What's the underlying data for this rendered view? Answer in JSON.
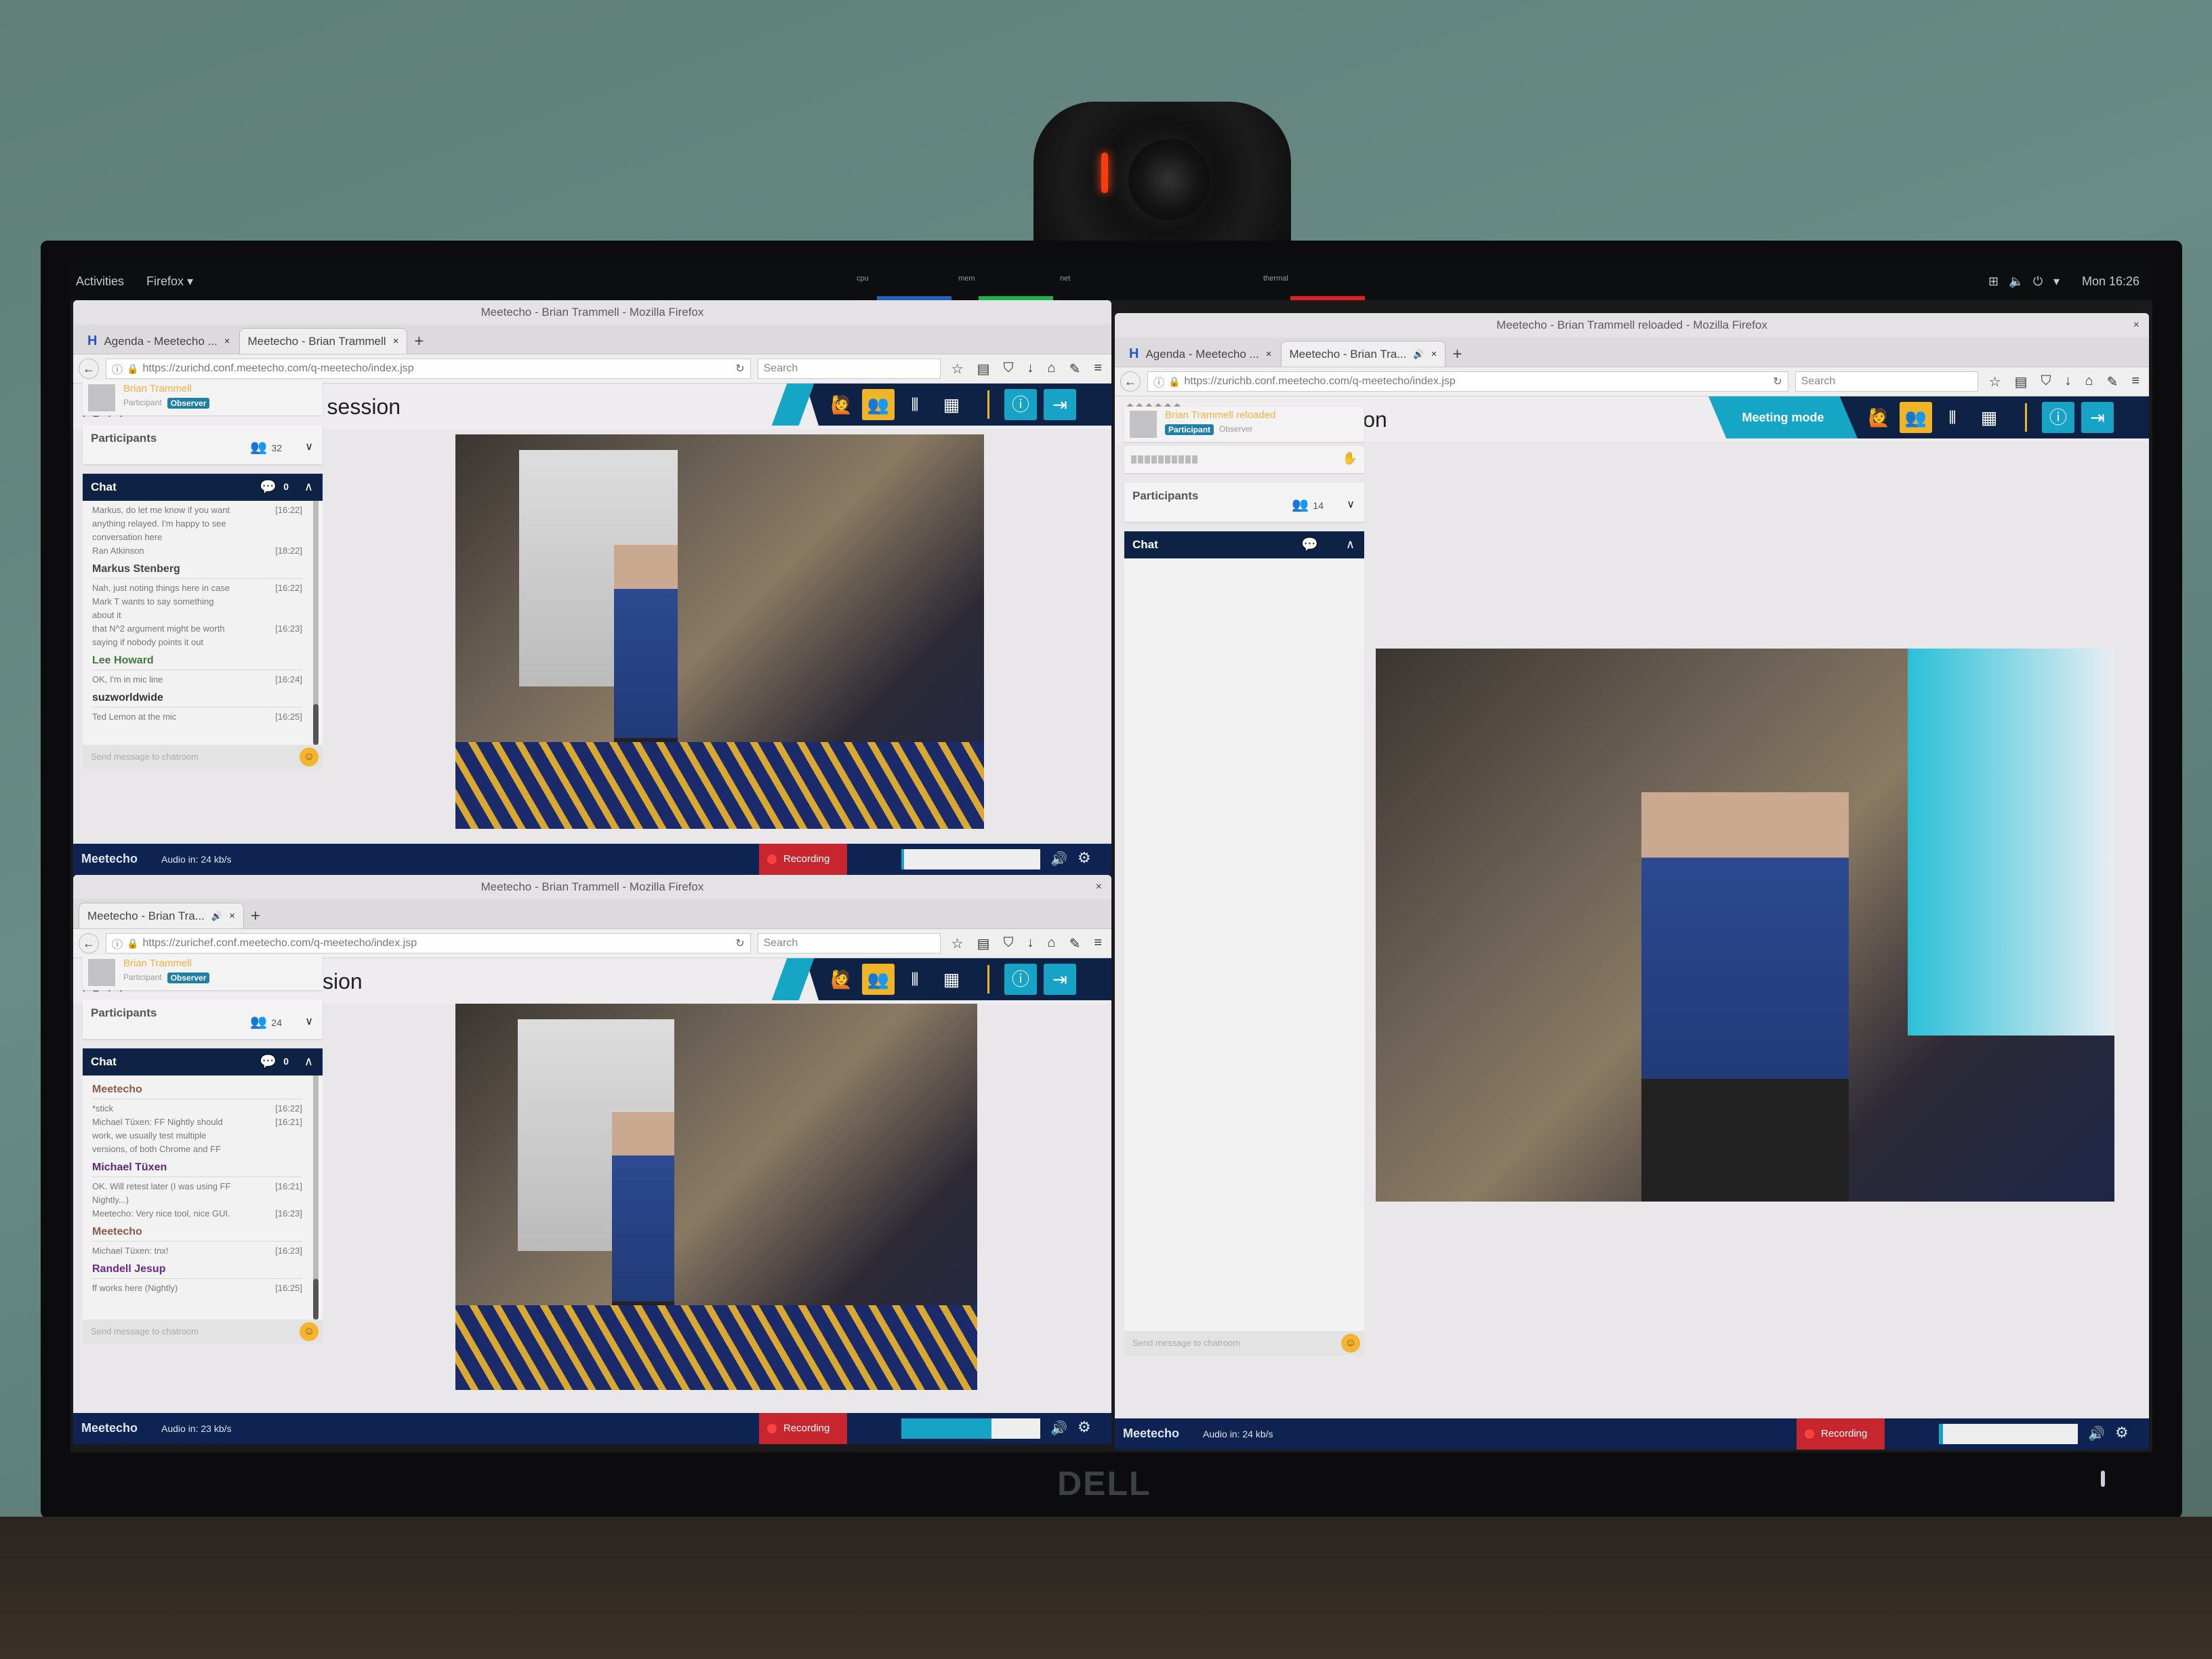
{
  "desktop": {
    "activities": "Activities",
    "app_menu": "Firefox ▾",
    "meters": [
      "cpu",
      "mem",
      "net",
      "thermal"
    ],
    "clock": "Mon 16:26"
  },
  "monitor_brand": "DELL",
  "colors": {
    "navy": "#0d2244",
    "cyan": "#15a6c6",
    "accent_yellow": "#f0b429",
    "recording_red": "#c8262e"
  },
  "windows": [
    {
      "title_bar": "Meetecho - Brian Trammell - Mozilla Firefox",
      "tabs": [
        {
          "label": "Agenda - Meetecho ...",
          "icon": "meetecho-icon",
          "active": false
        },
        {
          "label": "Meetecho - Brian Trammell",
          "active": true
        }
      ],
      "new_tab": "+",
      "url": "https://zurichd.conf.meetecho.com/q-meetecho/index.jsp",
      "search_placeholder": "Search",
      "logo_text": "IETF",
      "session_title": "IETF HOMENET session",
      "user": {
        "name": "Brian Trammell",
        "role": "Participant",
        "badge": "Observer"
      },
      "participants": {
        "label": "Participants",
        "count": "32"
      },
      "chat": {
        "label": "Chat",
        "unread": "0",
        "items": [
          {
            "text": "Markus, do let me know if you want anything relayed. I'm happy to see conversation here",
            "time": "[16:22]"
          },
          {
            "text": "Ran Atkinson",
            "time": "[18:22]"
          },
          {
            "author": "Markus Stenberg",
            "color": "#444444"
          },
          {
            "text": "Nah, just noting things here in case Mark T wants to say something about it",
            "time": "[16:22]"
          },
          {
            "text": "that N^2 argument might be worth saying if nobody points it out",
            "time": "[16:23]"
          },
          {
            "author": "Lee Howard",
            "color": "#3f7a3a"
          },
          {
            "text": "OK, I'm in mic line",
            "time": "[16:24]"
          },
          {
            "author": "suzworldwide",
            "color": "#333333"
          },
          {
            "text": "Ted Lemon at the mic",
            "time": "[16:25]"
          }
        ],
        "input_placeholder": "Send message to chatroom"
      },
      "footer": {
        "brand": "Meetecho",
        "audio": "Audio in: 24 kb/s",
        "recording": "Recording",
        "audio_level_percent": 2
      }
    },
    {
      "title_bar": "Meetecho - Brian Trammell - Mozilla Firefox",
      "tabs": [
        {
          "label": "Meetecho - Brian Tra...",
          "active": true,
          "audio": true
        }
      ],
      "new_tab": "+",
      "url": "https://zurichef.conf.meetecho.com/q-meetecho/index.jsp",
      "search_placeholder": "Search",
      "logo_text": "IETF",
      "session_title": "IETF ICCRG session",
      "user": {
        "name": "Brian Trammell",
        "role": "Participant",
        "badge": "Observer"
      },
      "participants": {
        "label": "Participants",
        "count": "24"
      },
      "chat": {
        "label": "Chat",
        "unread": "0",
        "items": [
          {
            "author": "Meetecho",
            "color": "#8a5a4a"
          },
          {
            "text": "*stick",
            "time": "[16:22]"
          },
          {
            "text": "Michael Tüxen: FF Nightly should work, we usually test multiple versions, of both Chrome and FF",
            "time": "[16:21]"
          },
          {
            "author": "Michael Tüxen",
            "color": "#5a2a7a"
          },
          {
            "text": "OK. Will retest later (I was using FF Nightly...)",
            "time": "[16:21]"
          },
          {
            "text": "Meetecho: Very nice tool, nice GUI.",
            "time": "[16:23]"
          },
          {
            "author": "Meetecho",
            "color": "#8a5a4a"
          },
          {
            "text": "Michael Tüxen: tnx!",
            "time": "[16:23]"
          },
          {
            "author": "Randell Jesup",
            "color": "#6a2a8a"
          },
          {
            "text": "ff works here (Nightly)",
            "time": "[16:25]"
          }
        ],
        "input_placeholder": "Send message to chatroom"
      },
      "footer": {
        "brand": "Meetecho",
        "audio": "Audio in: 23 kb/s",
        "recording": "Recording",
        "audio_level_percent": 65
      }
    },
    {
      "title_bar": "Meetecho - Brian Trammell reloaded - Mozilla Firefox",
      "tabs": [
        {
          "label": "Agenda - Meetecho ...",
          "icon": "meetecho-icon",
          "active": false
        },
        {
          "label": "Meetecho - Brian Tra...",
          "active": true,
          "audio": true
        }
      ],
      "new_tab": "+",
      "url": "https://zurichb.conf.meetecho.com/q-meetecho/index.jsp",
      "search_placeholder": "Search",
      "logo_text": "IETF",
      "session_title": "IETF IPPM session",
      "meeting_mode": "Meeting mode",
      "user": {
        "name": "Brian Trammell reloaded",
        "role": "Participant",
        "badge": "Observer",
        "role_active": true
      },
      "participants": {
        "label": "Participants",
        "count": "14"
      },
      "chat": {
        "label": "Chat",
        "unread": "",
        "items": [],
        "input_placeholder": "Send message to chatroom"
      },
      "footer": {
        "brand": "Meetecho",
        "audio": "Audio in: 24 kb/s",
        "recording": "Recording",
        "audio_level_percent": 3
      }
    }
  ]
}
